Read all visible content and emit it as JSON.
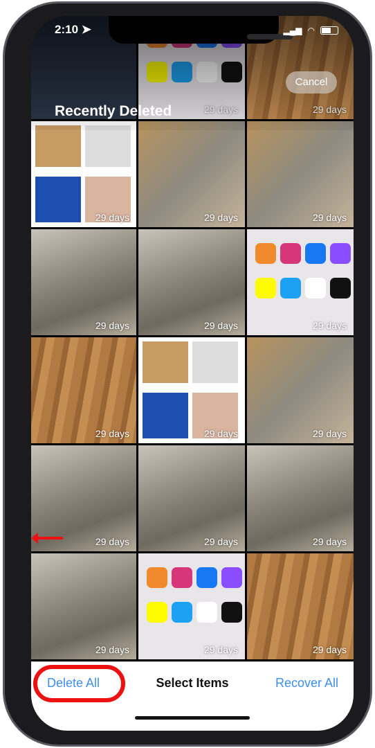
{
  "status_bar": {
    "time": "2:10",
    "location_icon": "location-arrow-icon",
    "signal_icon": "cellular-signal-icon",
    "wifi_icon": "wifi-icon",
    "battery_icon": "battery-icon"
  },
  "header": {
    "title": "Recently Deleted",
    "cancel_label": "Cancel"
  },
  "tiles": [
    {
      "type": "dark",
      "days": ""
    },
    {
      "type": "apps",
      "days": "29 days"
    },
    {
      "type": "wood",
      "days": "29 days"
    },
    {
      "type": "albums",
      "days": "29 days"
    },
    {
      "type": "coll",
      "days": "29 days"
    },
    {
      "type": "coll",
      "days": "29 days"
    },
    {
      "type": "grey",
      "days": "29 days"
    },
    {
      "type": "grey",
      "days": "29 days"
    },
    {
      "type": "apps",
      "days": "29 days"
    },
    {
      "type": "wood",
      "days": "29 days"
    },
    {
      "type": "albums",
      "days": "29 days"
    },
    {
      "type": "coll",
      "days": "29 days"
    },
    {
      "type": "grey",
      "days": "29 days"
    },
    {
      "type": "grey",
      "days": "29 days"
    },
    {
      "type": "grey",
      "days": "29 days"
    },
    {
      "type": "grey",
      "days": "29 days"
    },
    {
      "type": "apps",
      "days": "29 days"
    },
    {
      "type": "wood",
      "days": "29 days"
    }
  ],
  "toolbar": {
    "delete_all": "Delete All",
    "select_items": "Select Items",
    "recover_all": "Recover All"
  },
  "colors": {
    "accent": "#3d8ef0",
    "annotation": "#ee1111"
  }
}
